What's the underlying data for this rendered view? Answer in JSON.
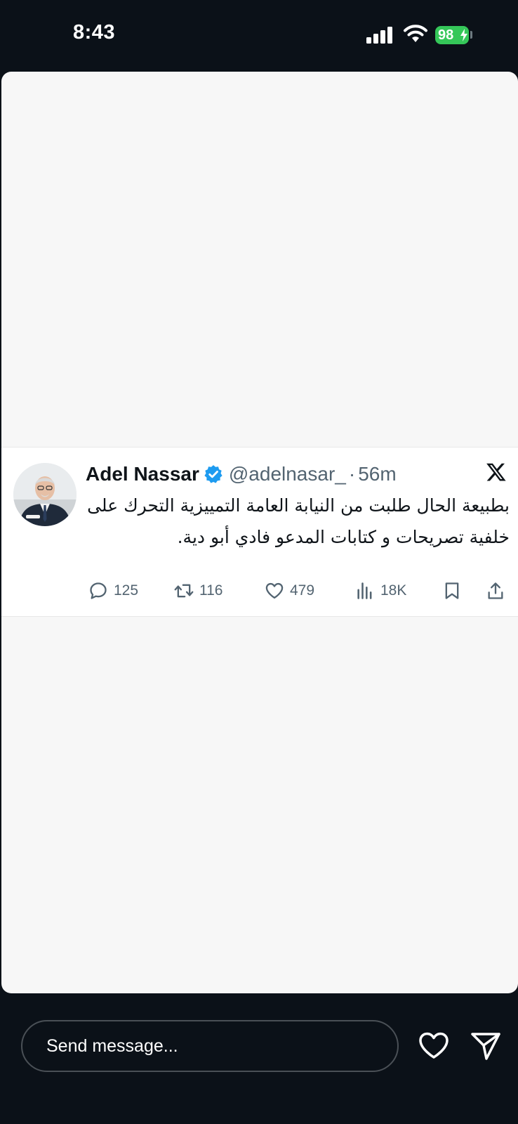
{
  "status_bar": {
    "time": "8:43",
    "battery_level": "98",
    "icons": [
      "signal-icon",
      "wifi-icon",
      "battery-charging-icon"
    ]
  },
  "tweet": {
    "author_name": "Adel Nassar",
    "handle": "@adelnasar_",
    "separator": "·",
    "time": "56m",
    "text": "بطبيعة الحال طلبت من النيابة العامة التمييزية التحرك على خلفية تصريحات و كتابات المدعو فادي أبو دية.",
    "stats": {
      "replies": "125",
      "retweets": "116",
      "likes": "479",
      "views": "18K"
    },
    "icons": [
      "verified-badge-icon",
      "x-logo-icon",
      "reply-icon",
      "retweet-icon",
      "like-icon",
      "views-icon",
      "bookmark-icon",
      "share-icon"
    ]
  },
  "bottom_bar": {
    "message_placeholder": "Send message...",
    "icons": [
      "heart-icon",
      "send-icon"
    ]
  },
  "colors": {
    "background": "#0b1118",
    "card": "#f7f7f7",
    "tweet_bg": "#ffffff",
    "verified": "#1d9bf0",
    "battery": "#35c759",
    "secondary_text": "#536471"
  }
}
